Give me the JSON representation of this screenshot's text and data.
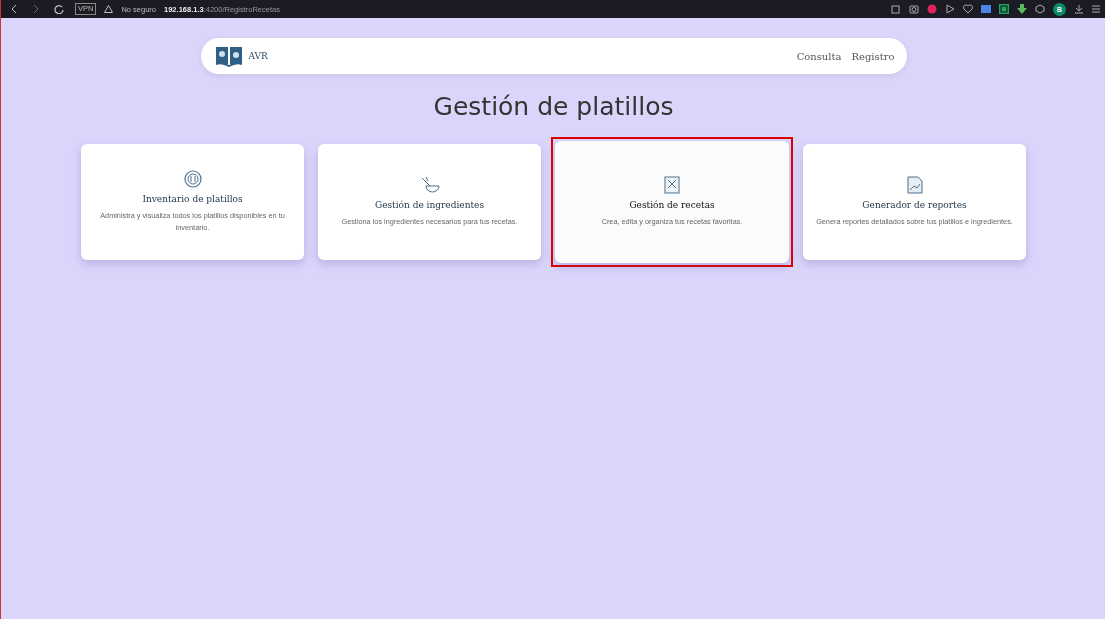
{
  "browser": {
    "vpn": "VPN",
    "security": "No seguro",
    "url_host": "192.168.1.3",
    "url_path": ":4200/RegistroRecetas",
    "profile": "B"
  },
  "navbar": {
    "brand": "AVR",
    "links": [
      {
        "label": "Consulta"
      },
      {
        "label": "Registro"
      }
    ]
  },
  "title": "Gestión de platillos",
  "cards": [
    {
      "kind": "plate",
      "title": "Inventario de platillos",
      "text": "Administra y visualiza todos los platillos disponibles en tu inventario.",
      "selected": false
    },
    {
      "kind": "bowl",
      "title": "Gestión de ingredientes",
      "text": "Gestiona los ingredientes necesarios para tus recetas.",
      "selected": false
    },
    {
      "kind": "recipe",
      "title": "Gestión de recetas",
      "text": "Crea, edita y organiza tus recetas favoritas.",
      "selected": true
    },
    {
      "kind": "report",
      "title": "Generador de reportes",
      "text": "Genera reportes detallados sobre tus platillos e ingredientes.",
      "selected": false
    }
  ]
}
